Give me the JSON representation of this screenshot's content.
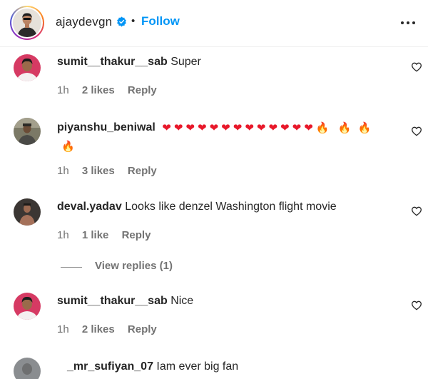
{
  "post_header": {
    "username": "ajaydevgn",
    "separator": "•",
    "follow_label": "Follow",
    "verified": true,
    "more_icon": "more-horizontal-icon"
  },
  "colors": {
    "link": "#0095f6",
    "verified_badge": "#0095f6",
    "meta_text": "#737373",
    "heart": "#e8182a",
    "fire": "#f47b16"
  },
  "comments": [
    {
      "username": "sumit__thakur__sab",
      "text": "Super",
      "time": "1h",
      "likes": "2 likes",
      "reply_label": "Reply"
    },
    {
      "username": "piyanshu_beniwal",
      "text": "",
      "emojis": [
        "❤",
        "❤",
        "❤",
        "❤",
        "❤",
        "❤",
        "❤",
        "❤",
        "❤",
        "❤",
        "❤",
        "❤",
        "❤",
        "🔥",
        "🔥",
        "🔥",
        "🔥"
      ],
      "time": "1h",
      "likes": "3 likes",
      "reply_label": "Reply"
    },
    {
      "username": "deval.yadav",
      "text": "Looks like denzel Washington flight movie",
      "time": "1h",
      "likes": "1 like",
      "reply_label": "Reply",
      "view_replies_label": "View replies (1)"
    },
    {
      "username": "sumit__thakur__sab",
      "text": "Nice",
      "time": "1h",
      "likes": "2 likes",
      "reply_label": "Reply"
    },
    {
      "username": "_mr_sufiyan_07",
      "text": "Iam ever big fan"
    }
  ]
}
